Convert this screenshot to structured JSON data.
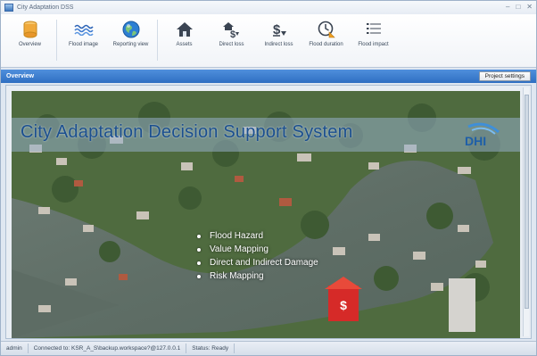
{
  "window": {
    "title": "City Adaptation DSS",
    "controls": [
      "–",
      "□",
      "✕"
    ]
  },
  "ribbon": {
    "buttons": [
      {
        "label": "Overview",
        "icon": "cylinder-icon"
      },
      {
        "label": "Flood image",
        "icon": "flood-image-icon"
      },
      {
        "label": "Reporting view",
        "icon": "globe-icon"
      },
      {
        "label": "Assets",
        "icon": "house-icon"
      },
      {
        "label": "Direct loss",
        "icon": "direct-loss-icon"
      },
      {
        "label": "Indirect loss",
        "icon": "indirect-loss-icon"
      },
      {
        "label": "Flood duration",
        "icon": "clock-icon"
      },
      {
        "label": "Flood impact",
        "icon": "list-icon"
      }
    ]
  },
  "section": {
    "title": "Overview",
    "project_settings_label": "Project settings"
  },
  "overview": {
    "banner_title": "City Adaptation Decision Support System",
    "logo_text": "DHI",
    "bullets": [
      "Flood Hazard",
      "Value Mapping",
      "Direct and Indirect Damage",
      "Risk Mapping"
    ]
  },
  "status": {
    "user": "admin",
    "connection": "Connected to: KSR_A_S\\backup.workspace?@127.0.0.1",
    "state": "Status: Ready"
  },
  "colors": {
    "section_bar": "#3d7fd1",
    "banner_title": "#1b4f8f",
    "logo": "#1e5fa8"
  }
}
